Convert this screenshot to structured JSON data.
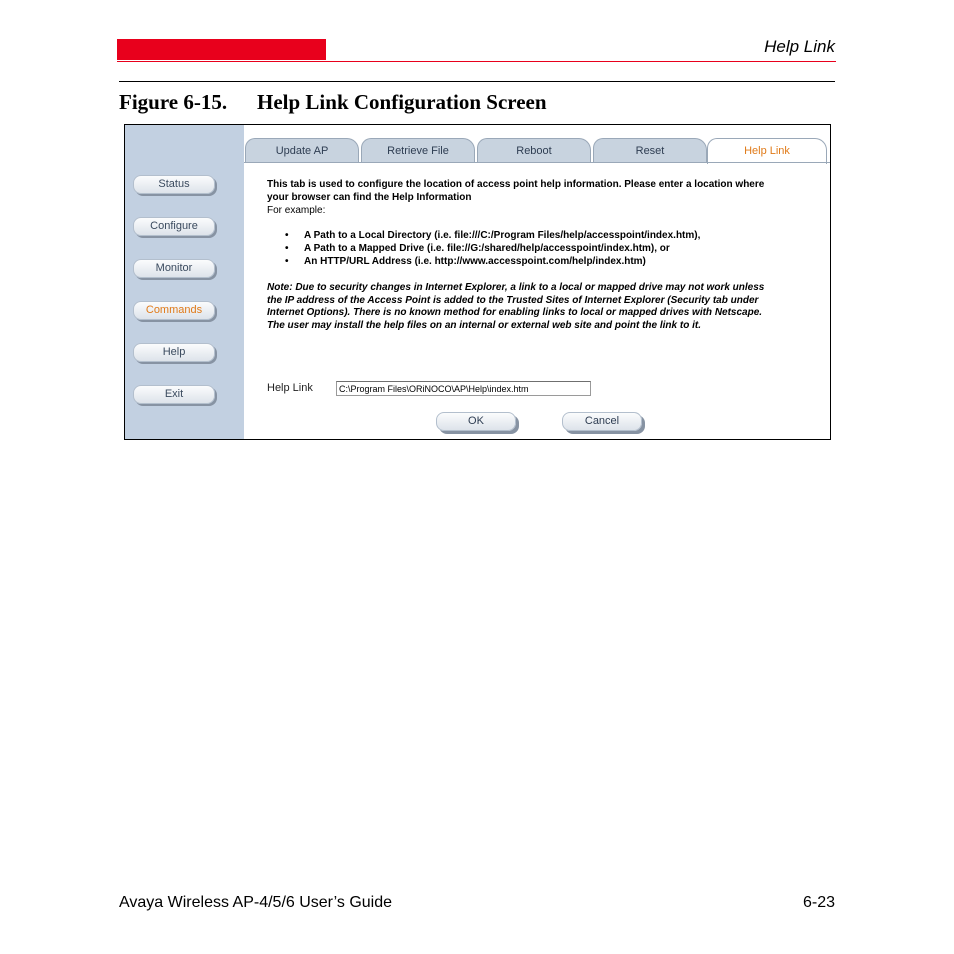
{
  "header": {
    "section_title": "Help Link",
    "accent_color": "#e8001c"
  },
  "figure": {
    "number": "Figure 6-15.",
    "title": "Help Link Configuration Screen"
  },
  "screen": {
    "nav": [
      {
        "label": "Status",
        "active": false
      },
      {
        "label": "Configure",
        "active": false
      },
      {
        "label": "Monitor",
        "active": false
      },
      {
        "label": "Commands",
        "active": true
      },
      {
        "label": "Help",
        "active": false
      },
      {
        "label": "Exit",
        "active": false
      }
    ],
    "tabs": [
      {
        "label": "Update AP",
        "active": false
      },
      {
        "label": "Retrieve File",
        "active": false
      },
      {
        "label": "Reboot",
        "active": false
      },
      {
        "label": "Reset",
        "active": false
      },
      {
        "label": "Help Link",
        "active": true
      }
    ],
    "intro_line1": "This tab is used to configure the location of access point help information. Please enter a location where",
    "intro_line2": "your browser can find the Help Information",
    "intro_line3": "For example:",
    "examples": [
      "A Path to a Local Directory (i.e. file:///C:/Program Files/help/accesspoint/index.htm),",
      "A Path to a Mapped Drive (i.e. file://G:/shared/help/accesspoint/index.htm), or",
      "An HTTP/URL Address (i.e. http://www.accesspoint.com/help/index.htm)"
    ],
    "note_lines": [
      "Note: Due to security changes in Internet Explorer, a link to a local or mapped drive may not work unless",
      "the IP address of the Access Point is added to the Trusted Sites of Internet Explorer (Security tab under",
      "Internet Options). There is no known method for enabling links to local or mapped drives with Netscape.",
      "The user may install the help files on an internal or external web site and point the link to it."
    ],
    "help_link_label": "Help Link",
    "help_link_value": "C:\\Program Files\\ORiNOCO\\AP\\Help\\index.htm",
    "ok_label": "OK",
    "cancel_label": "Cancel"
  },
  "footer": {
    "guide_title": "Avaya Wireless AP-4/5/6 User’s Guide",
    "page_number": "6-23"
  }
}
